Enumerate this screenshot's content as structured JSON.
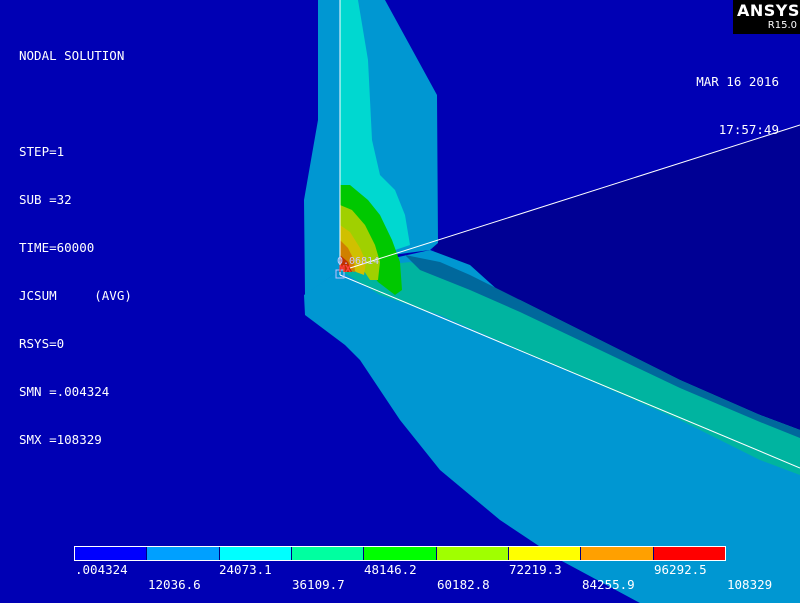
{
  "logo": {
    "name": "ANSYS",
    "version": "R15.0"
  },
  "solution_title": "NODAL SOLUTION",
  "info_lines": [
    "STEP=1",
    "SUB =32",
    "TIME=60000",
    "JCSUM     (AVG)",
    "RSYS=0",
    "SMN =.004324",
    "SMX =108329"
  ],
  "date": "MAR 16 2016",
  "time": "17:57:49",
  "max_marker": {
    "value_label": "0.06814",
    "tag": "MX"
  },
  "legend": {
    "colors": [
      "#0000ff",
      "#00a0ff",
      "#00ffff",
      "#00ffa0",
      "#00ff00",
      "#a0ff00",
      "#ffff00",
      "#ffa000",
      "#ff0000"
    ],
    "labels_top": [
      ".004324",
      "24073.1",
      "48146.2",
      "72219.3",
      "96292.5"
    ],
    "labels_bottom": [
      "12036.6",
      "36109.7",
      "60182.8",
      "84255.9",
      "108329"
    ]
  },
  "palette": {
    "background": "#0000b4",
    "region_navy": "#000094",
    "band_mid_blue": "#0097d2",
    "band_teal": "#00c8c8",
    "band_cyan": "#00e6d2",
    "band_green_teal": "#00b4a0",
    "band_green": "#00c800",
    "band_yellow_green": "#a0d000",
    "band_gold": "#d0c000",
    "band_orange": "#d08000",
    "band_red": "#c03000"
  }
}
